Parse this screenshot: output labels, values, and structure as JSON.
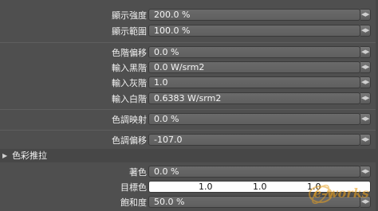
{
  "rows": [
    {
      "label": "顯示強度",
      "value": "200.0 %"
    },
    {
      "label": "顯示範圍",
      "value": "100.0 %"
    },
    {
      "label": "色階偏移",
      "value": "0.0 %"
    },
    {
      "label": "輸入黑階",
      "value": "0.0 W/srm2"
    },
    {
      "label": "輸入灰階",
      "value": "1.0"
    },
    {
      "label": "輸入白階",
      "value": "0.6383 W/srm2"
    },
    {
      "label": "色調映射",
      "value": "0.0 %"
    },
    {
      "label": "色調偏移",
      "value": "-107.0"
    }
  ],
  "section": {
    "title": "色彩推拉",
    "rows": [
      {
        "label": "著色",
        "value": "0.0 %"
      },
      {
        "label": "目標色",
        "values": [
          "1.0",
          "1.0",
          "1.0"
        ],
        "swatch_color": "#ffffff"
      },
      {
        "label": "飽和度",
        "value": "50.0 %"
      }
    ]
  },
  "watermark": "e-works",
  "colors": {
    "panel_bg": "#4f4f4f",
    "field_bg": "#646464",
    "text": "#f0f0f0",
    "watermark": "#e8a020"
  }
}
